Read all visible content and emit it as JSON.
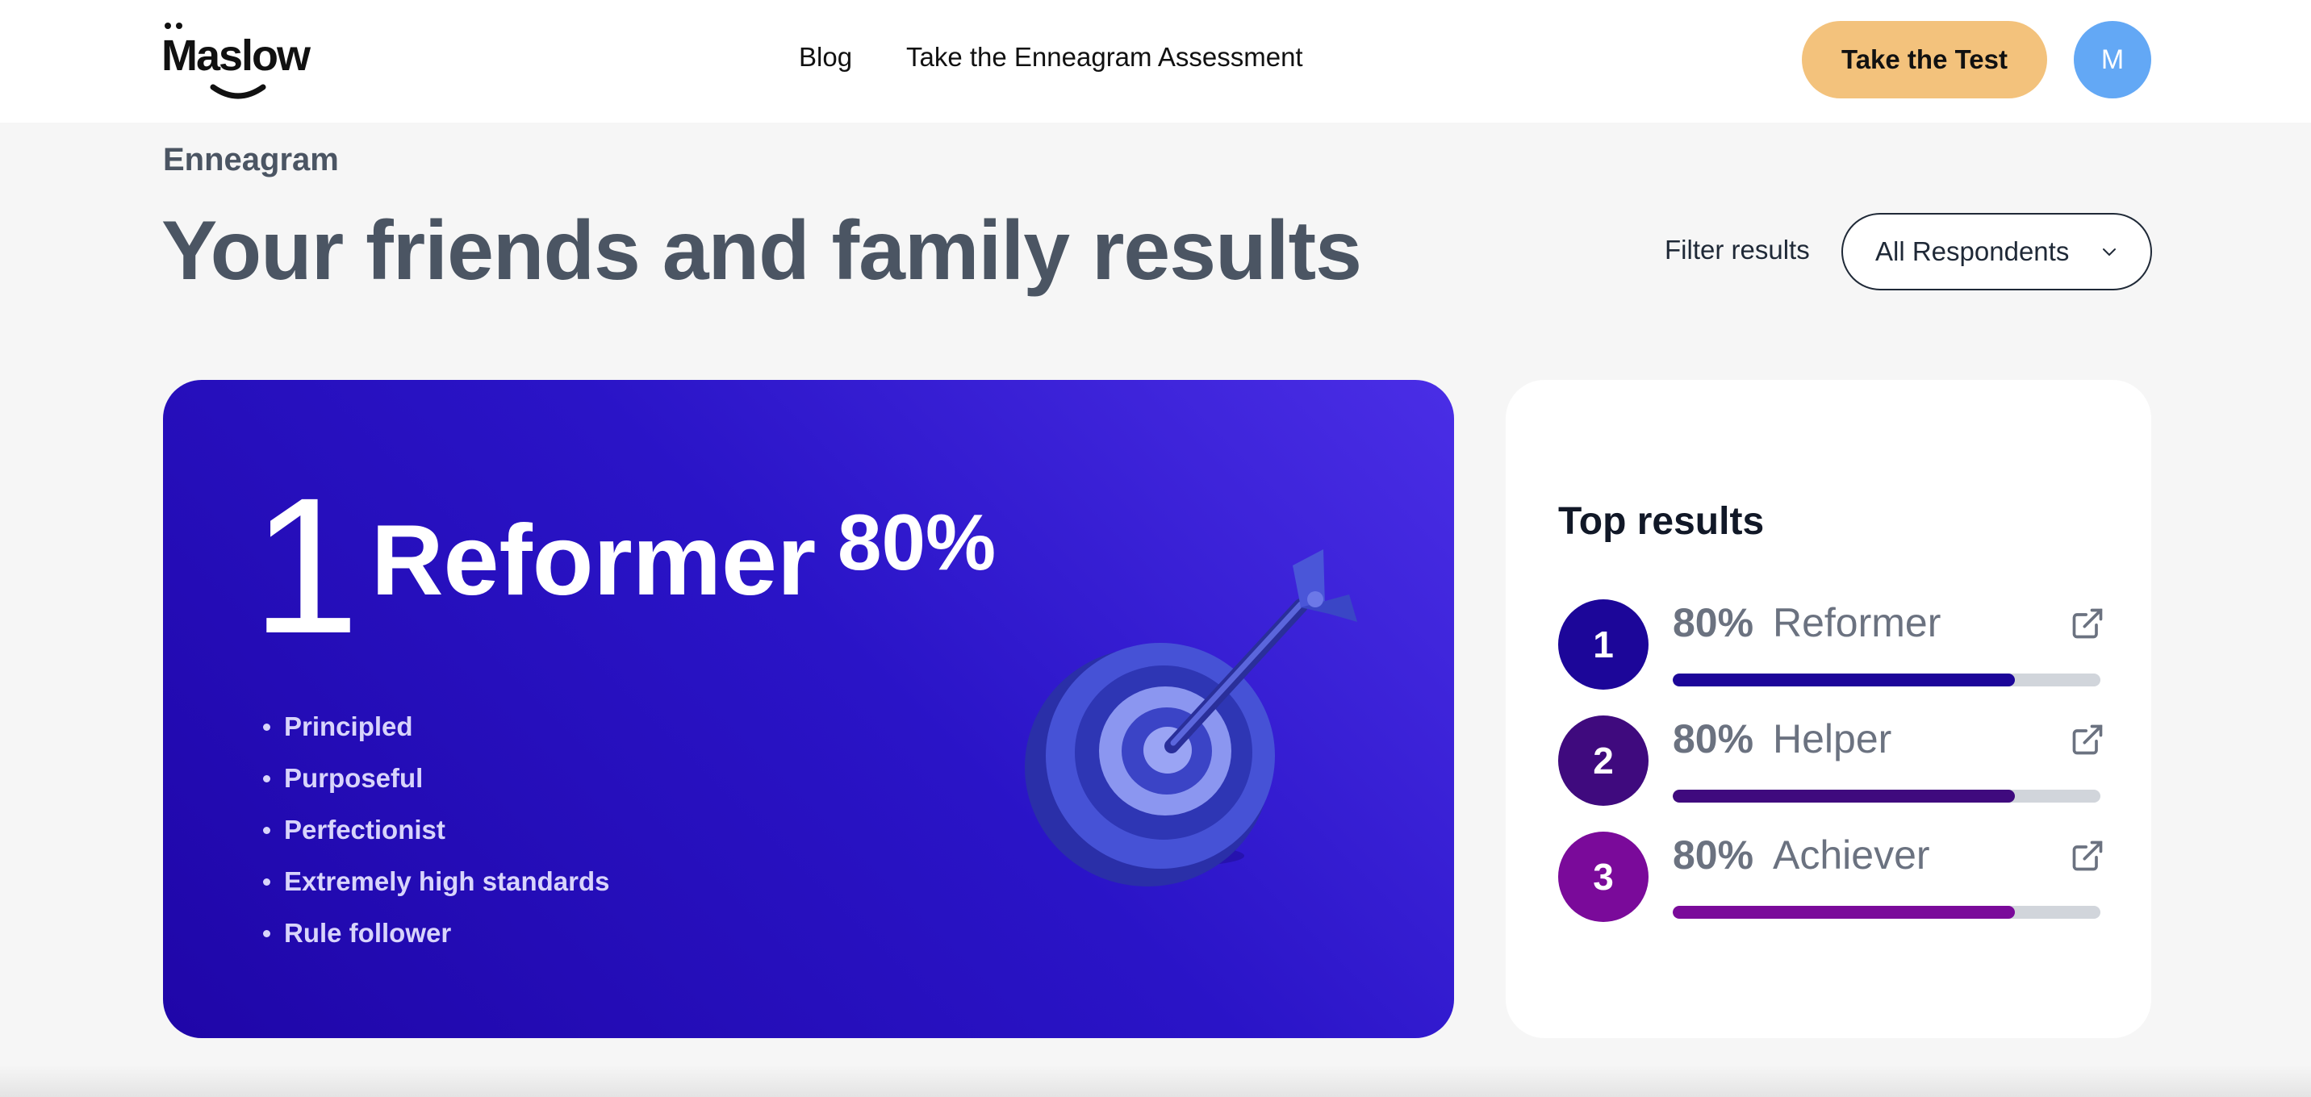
{
  "header": {
    "logo_text": "Maslow",
    "nav": [
      {
        "label": "Blog"
      },
      {
        "label": "Take the Enneagram Assessment"
      }
    ],
    "cta_label": "Take the Test",
    "avatar_initial": "M"
  },
  "page": {
    "eyebrow": "Enneagram",
    "title": "Your friends and family results",
    "filter_label": "Filter results",
    "filter_value": "All Respondents"
  },
  "hero": {
    "number": "1",
    "name": "Reformer",
    "percent": "80%",
    "traits": [
      "Principled",
      "Purposeful",
      "Perfectionist",
      "Extremely high standards",
      "Rule follower"
    ],
    "icon": "target-dart-icon"
  },
  "top_results": {
    "title": "Top results",
    "items": [
      {
        "rank": "1",
        "percent": "80%",
        "name": "Reformer",
        "progress": 0.8,
        "color": "#1c0699"
      },
      {
        "rank": "2",
        "percent": "80%",
        "name": "Helper",
        "progress": 0.8,
        "color": "#3f0a7e"
      },
      {
        "rank": "3",
        "percent": "80%",
        "name": "Achiever",
        "progress": 0.8,
        "color": "#7a0a9a"
      }
    ]
  },
  "colors": {
    "cta": "#f3c27c",
    "avatar": "#63a8f5",
    "hero_gradient_start": "#4a2ee6",
    "hero_gradient_end": "#1f06a8",
    "track": "#d1d5db"
  }
}
